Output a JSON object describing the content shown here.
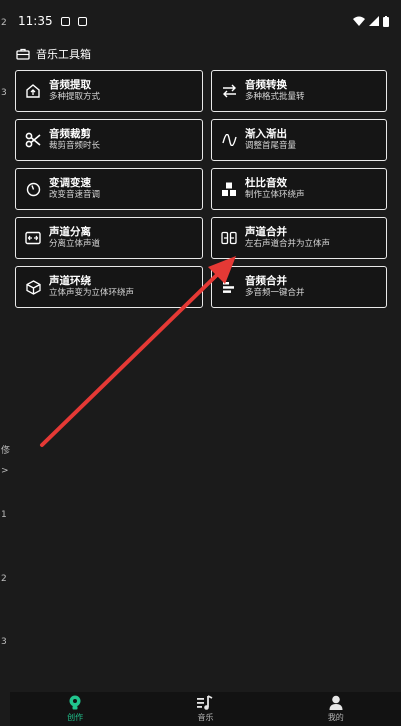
{
  "status_bar": {
    "time": "11:35"
  },
  "header": {
    "title": "音乐工具箱",
    "icon": "toolbox-icon"
  },
  "tools": [
    {
      "title": "音频提取",
      "subtitle": "多种提取方式",
      "icon": "extract-icon"
    },
    {
      "title": "音频转换",
      "subtitle": "多种格式批量转",
      "icon": "convert-arrows-icon"
    },
    {
      "title": "音频裁剪",
      "subtitle": "裁剪音频时长",
      "icon": "scissors-icon"
    },
    {
      "title": "渐入渐出",
      "subtitle": "调整首尾音量",
      "icon": "wave-icon"
    },
    {
      "title": "变调变速",
      "subtitle": "改变音速音调",
      "icon": "speed-gauge-icon"
    },
    {
      "title": "杜比音效",
      "subtitle": "制作立体环绕声",
      "icon": "cubes-icon"
    },
    {
      "title": "声道分离",
      "subtitle": "分离立体声道",
      "icon": "split-channel-icon"
    },
    {
      "title": "声道合并",
      "subtitle": "左右声道合并为立体声",
      "icon": "merge-channel-icon"
    },
    {
      "title": "声道环绕",
      "subtitle": "立体声变为立体环绕声",
      "icon": "cube-icon"
    },
    {
      "title": "音频合并",
      "subtitle": "多音频一键合并",
      "icon": "merge-bars-icon"
    }
  ],
  "edge_marks": [
    "2",
    "3",
    "",
    "俢",
    ">",
    "1",
    "2",
    "3"
  ],
  "bottom_nav": {
    "items": [
      {
        "label": "创作",
        "icon": "lightbulb-icon",
        "active": true
      },
      {
        "label": "音乐",
        "icon": "music-list-icon",
        "active": false
      },
      {
        "label": "我的",
        "icon": "user-icon",
        "active": false
      }
    ]
  },
  "colors": {
    "background": "#1b1b1b",
    "accent": "#21c48d",
    "annotation_arrow": "#e53935"
  }
}
